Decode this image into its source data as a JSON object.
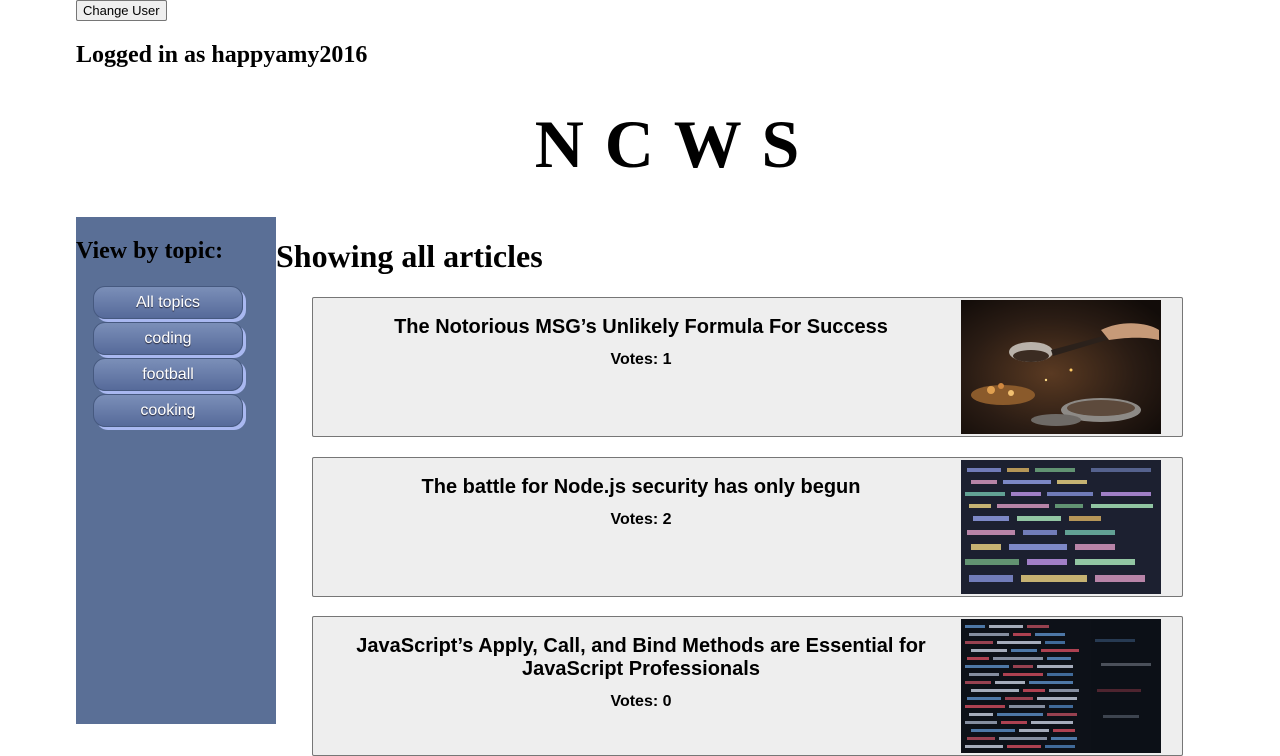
{
  "header": {
    "change_user_label": "Change User",
    "logged_in_text": "Logged in as happyamy2016",
    "logo_text": "N C W S"
  },
  "sidebar": {
    "heading": "View by topic:",
    "topics": [
      "All topics",
      "coding",
      "football",
      "cooking"
    ]
  },
  "main": {
    "heading": "Showing all articles",
    "articles": [
      {
        "title": "The Notorious MSG’s Unlikely Formula For Success",
        "votes": "Votes: 1",
        "image": "cooking-pan-photo"
      },
      {
        "title": "The battle for Node.js security has only begun",
        "votes": "Votes: 2",
        "image": "code-screen-photo"
      },
      {
        "title": "JavaScript’s Apply, Call, and Bind Methods are Essential for JavaScript Professionals",
        "votes": "Votes: 0",
        "image": "code-screen-dark-photo"
      }
    ]
  },
  "colors": {
    "sidebar_bg": "#5a6f96",
    "article_bg": "#eeeeee",
    "button_shadow": "#a9b8f0"
  }
}
